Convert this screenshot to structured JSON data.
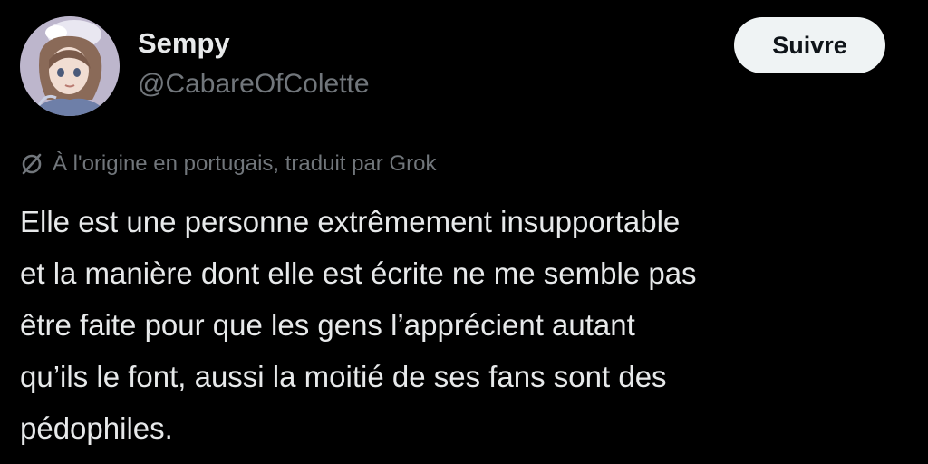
{
  "author": {
    "display_name": "Sempy",
    "handle": "@CabareOfColette",
    "avatar_icon": "anime-character-avatar"
  },
  "follow_button": {
    "label": "Suivre"
  },
  "translation": {
    "icon": "no-translate-icon",
    "note": "À l'origine en portugais, traduit par Grok"
  },
  "tweet": {
    "lines": [
      "Elle est une personne extrêmement insupportable",
      "et la manière dont elle est écrite ne me semble pas",
      "être faite pour que les gens l’apprécient autant",
      "qu’ils le font, aussi la moitié de ses fans sont des",
      "pédophiles."
    ]
  },
  "colors": {
    "background": "#000000",
    "primary_text": "#e7e9ea",
    "secondary_text": "#71767b",
    "button_background": "#eff3f4",
    "button_text": "#0f1419"
  }
}
